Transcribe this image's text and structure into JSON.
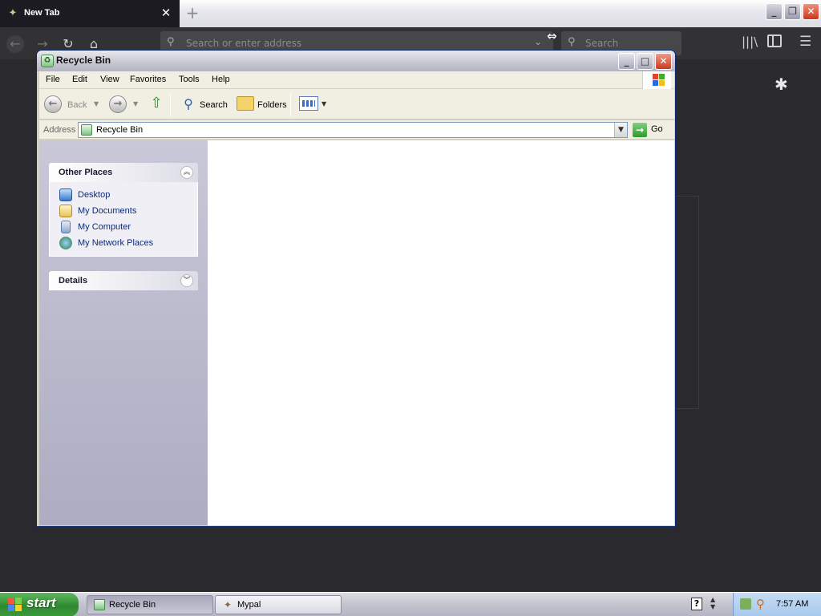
{
  "browser": {
    "tab_title": "New Tab",
    "tab_close": "✕",
    "new_tab": "+",
    "url_placeholder": "Search or enter address",
    "search_placeholder": "Search"
  },
  "explorer": {
    "title": "Recycle Bin",
    "menu": [
      "File",
      "Edit",
      "View",
      "Favorites",
      "Tools",
      "Help"
    ],
    "toolbar": {
      "back": "Back",
      "search": "Search",
      "folders": "Folders"
    },
    "address": {
      "label": "Address",
      "value": "Recycle Bin",
      "go": "Go"
    },
    "taskpane": {
      "other_places": {
        "title": "Other Places",
        "items": [
          "Desktop",
          "My Documents",
          "My Computer",
          "My Network Places"
        ]
      },
      "details": {
        "title": "Details"
      }
    }
  },
  "taskbar": {
    "start": "start",
    "tasks": [
      "Recycle Bin",
      "Mypal"
    ],
    "time": "7:57 AM"
  },
  "colors": {
    "browser_bg": "#2a2a2e",
    "xp_green": "#3b9a3b",
    "link_blue": "#0c2a78",
    "taskpane_bg": "#c9c8d8"
  }
}
